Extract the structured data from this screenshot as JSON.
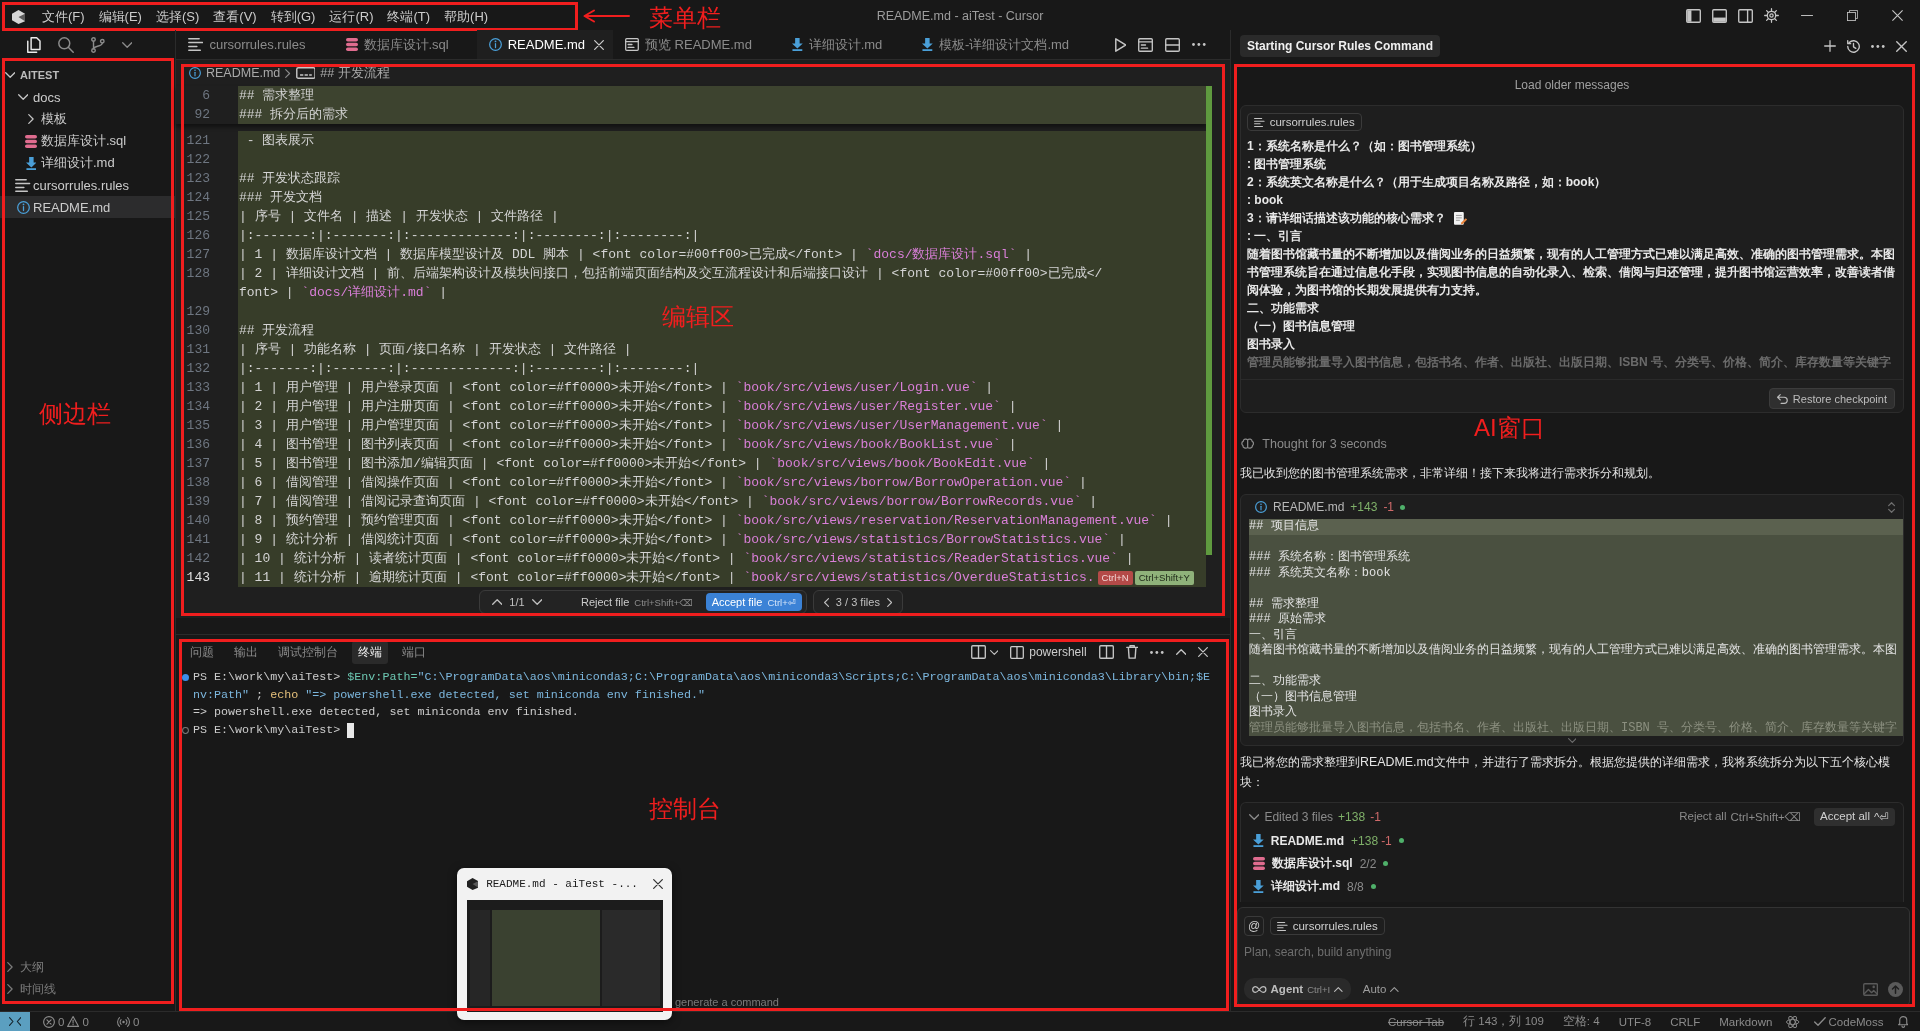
{
  "title_bar": {
    "menu": [
      "文件(F)",
      "编辑(E)",
      "选择(S)",
      "查看(V)",
      "转到(G)",
      "运行(R)",
      "终端(T)",
      "帮助(H)"
    ],
    "annotation": "菜单栏",
    "title": "README.md - aiTest - Cursor"
  },
  "sidebar": {
    "annotation": "侧边栏",
    "views": [
      {
        "kind": "explorer",
        "selected": true
      },
      {
        "kind": "search",
        "selected": false
      },
      {
        "kind": "source_control",
        "selected": false
      }
    ],
    "root": {
      "label": "AITEST",
      "expanded": true,
      "children": [
        {
          "label": "docs",
          "kind": "folder",
          "expanded": true,
          "selected": false,
          "children": [
            {
              "label": "模板",
              "kind": "folder",
              "expanded": false,
              "selected": false
            },
            {
              "label": "数据库设计.sql",
              "kind": "sql",
              "selected": false
            },
            {
              "label": "详细设计.md",
              "kind": "md",
              "selected": false
            }
          ]
        },
        {
          "label": "cursorrules.rules",
          "kind": "rules",
          "selected": false
        },
        {
          "label": "README.md",
          "kind": "readme",
          "selected": true
        }
      ]
    },
    "sections": [
      {
        "label": "大纲",
        "expanded": false
      },
      {
        "label": "时间线",
        "expanded": false
      }
    ]
  },
  "editor": {
    "annotation": "编辑区",
    "tabs": [
      {
        "label": "cursorrules.rules",
        "kind": "rules",
        "selected": false
      },
      {
        "label": "数据库设计.sql",
        "kind": "sql",
        "selected": false
      },
      {
        "label": "README.md",
        "kind": "readme",
        "selected": true
      },
      {
        "label": "预览 README.md",
        "kind": "preview",
        "selected": false
      },
      {
        "label": "详细设计.md",
        "kind": "md",
        "selected": false
      },
      {
        "label": "模板-详细设计文档.md",
        "kind": "md",
        "selected": false
      }
    ],
    "breadcrumb": [
      {
        "label": "README.md",
        "kind": "readme"
      },
      {
        "label": "## 开发流程",
        "kind": "string"
      }
    ],
    "sticky_lines": [
      {
        "number": "6",
        "text": "## 需求整理"
      },
      {
        "number": "92",
        "text": "### 拆分后的需求"
      }
    ],
    "lines": [
      {
        "number": "121",
        "text": " - 图表展示",
        "added": true,
        "current": false
      },
      {
        "number": "122",
        "added": true,
        "current": false
      },
      {
        "number": "123",
        "text": "## 开发状态跟踪",
        "added": true,
        "current": false
      },
      {
        "number": "124",
        "text": "### 开发文档",
        "added": true,
        "current": false
      },
      {
        "number": "125",
        "text": "| 序号 | 文件名 | 描述 | 开发状态 | 文件路径 |",
        "added": true,
        "current": false
      },
      {
        "number": "126",
        "text": "|:-------:|:-------:|:-------------:|:--------:|:--------:|",
        "added": true,
        "current": false
      },
      {
        "number": "127",
        "text": "| 1 | 数据库设计文档 | 数据库模型设计及 DDL 脚本 | <font color=#00ff00>已完成</font> | `docs/数据库设计.sql` |",
        "added": true,
        "current": false
      },
      {
        "number": "128",
        "text": "| 2 | 详细设计文档 | 前、后端架构设计及模块间接口，包括前端页面结构及交互流程设计和后端接口设计 | <font color=#00ff00>已完成</",
        "wrap": "font> | `docs/详细设计.md` |",
        "added": true,
        "current": false
      },
      {
        "number": "129",
        "added": true,
        "current": false
      },
      {
        "number": "130",
        "text": "## 开发流程",
        "added": true,
        "current": false
      },
      {
        "number": "131",
        "text": "| 序号 | 功能名称 | 页面/接口名称 | 开发状态 | 文件路径 |",
        "added": true,
        "current": false
      },
      {
        "number": "132",
        "text": "|:-------:|:-------:|:-------------:|:--------:|:--------:|",
        "added": true,
        "current": false
      },
      {
        "number": "133",
        "text": "| 1 | 用户管理 | 用户登录页面 | <font color=#ff0000>未开始</font> | `book/src/views/user/Login.vue` |",
        "added": true,
        "current": false
      },
      {
        "number": "134",
        "text": "| 2 | 用户管理 | 用户注册页面 | <font color=#ff0000>未开始</font> | `book/src/views/user/Register.vue` |",
        "added": true,
        "current": false
      },
      {
        "number": "135",
        "text": "| 3 | 用户管理 | 用户管理页面 | <font color=#ff0000>未开始</font> | `book/src/views/user/UserManagement.vue` |",
        "added": true,
        "current": false
      },
      {
        "number": "136",
        "text": "| 4 | 图书管理 | 图书列表页面 | <font color=#ff0000>未开始</font> | `book/src/views/book/BookList.vue` |",
        "added": true,
        "current": false
      },
      {
        "number": "137",
        "text": "| 5 | 图书管理 | 图书添加/编辑页面 | <font color=#ff0000>未开始</font> | `book/src/views/book/BookEdit.vue` |",
        "added": true,
        "current": false
      },
      {
        "number": "138",
        "text": "| 6 | 借阅管理 | 借阅操作页面 | <font color=#ff0000>未开始</font> | `book/src/views/borrow/BorrowOperation.vue` |",
        "added": true,
        "current": false
      },
      {
        "number": "139",
        "text": "| 7 | 借阅管理 | 借阅记录查询页面 | <font color=#ff0000>未开始</font> | `book/src/views/borrow/BorrowRecords.vue` |",
        "added": true,
        "current": false
      },
      {
        "number": "140",
        "text": "| 8 | 预约管理 | 预约管理页面 | <font color=#ff0000>未开始</font> | `book/src/views/reservation/ReservationManagement.vue` |",
        "added": true,
        "current": false
      },
      {
        "number": "141",
        "text": "| 9 | 统计分析 | 借阅统计页面 | <font color=#ff0000>未开始</font> | `book/src/views/statistics/BorrowStatistics.vue` |",
        "added": true,
        "current": false
      },
      {
        "number": "142",
        "text": "| 10 | 统计分析 | 读者统计页面 | <font color=#ff0000>未开始</font> | `book/src/views/statistics/ReaderStatistics.vue` |",
        "added": true,
        "current": false
      },
      {
        "number": "143",
        "text": "| 11 | 统计分析 | 逾期统计页面 | <font color=#ff0000>未开始</font> | `book/src/views/statistics/OverdueStatistics.",
        "added": true,
        "current": true,
        "actions": [
          {
            "label": "Ctrl+N",
            "kind": "reject"
          },
          {
            "label": "Ctrl+Shift+Y",
            "kind": "accept"
          }
        ]
      }
    ],
    "review_bar": {
      "hunks": "1/1",
      "reject": "Reject file",
      "reject_keys": "Ctrl+Shift+⌫",
      "accept": "Accept file",
      "accept_keys": "Ctrl+⏎",
      "files": "3 / 3 files"
    }
  },
  "panel": {
    "annotation": "控制台",
    "tabs": [
      {
        "label": "问题",
        "selected": false
      },
      {
        "label": "输出",
        "selected": false
      },
      {
        "label": "调试控制台",
        "selected": false
      },
      {
        "label": "终端",
        "selected": true
      },
      {
        "label": "端口",
        "selected": false
      }
    ],
    "shell": "powershell",
    "rows": [
      {
        "kind": "command",
        "succeeded": true,
        "prompt": "PS E:\\work\\my\\aiTest>",
        "cursor": false,
        "segments": [
          {
            "kind": "variable",
            "text": "$Env:Path="
          },
          {
            "kind": "string",
            "text": "\"C:\\ProgramData\\aos\\miniconda3;C:\\ProgramData\\aos\\miniconda3\\Scripts;C:\\ProgramData\\aos\\miniconda3\\Library\\bin;$E"
          }
        ],
        "wrap": [
          {
            "kind": "string",
            "text": "nv:Path\""
          },
          {
            "kind": "plain",
            "text": " ; "
          },
          {
            "kind": "command",
            "text": "echo"
          },
          {
            "kind": "string",
            "text": " \"=> powershell.exe detected, set miniconda env finished.\""
          }
        ]
      },
      {
        "kind": "output",
        "text": "=> powershell.exe detected, set miniconda env finished."
      },
      {
        "kind": "command",
        "succeeded": false,
        "prompt": "PS E:\\work\\my\\aiTest>",
        "cursor": true
      }
    ],
    "hint": "generate a command",
    "preview_window": {
      "title": "README.md - aiTest -..."
    }
  },
  "ai_panel": {
    "annotation": "AI窗口",
    "title": "Starting Cursor Rules Command",
    "load_older": "Load older messages",
    "user_message": {
      "chip": "cursorrules.rules",
      "lines": [
        {
          "kind": "plain",
          "text": "1：系统名称是什么？（如：图书管理系统）"
        },
        {
          "kind": "plain",
          "text": ": 图书管理系统"
        },
        {
          "kind": "plain",
          "text": "2：系统英文名称是什么？（用于生成项目名称及路径，如：book）"
        },
        {
          "kind": "plain",
          "text": ": book"
        },
        {
          "kind": "memo",
          "text": "3：请详细话描述该功能的核心需求？"
        },
        {
          "kind": "plain",
          "text": ": 一、引言"
        },
        {
          "kind": "plain",
          "text": "随着图书馆藏书量的不断增加以及借阅业务的日益频繁，现有的人工管理方式已难以满足高效、准确的图书管理需求。本图书管理系统旨在通过信息化手段，实现图书信息的自动化录入、检索、借阅与归还管理，提升图书馆运营效率，改善读者借阅体验，为图书馆的长期发展提供有力支持。"
        },
        {
          "kind": "plain",
          "text": "二、功能需求"
        },
        {
          "kind": "plain",
          "text": "（一）图书信息管理"
        },
        {
          "kind": "plain",
          "text": "图书录入"
        },
        {
          "kind": "faded",
          "text": "管理员能够批量导入图书信息，包括书名、作者、出版社、出版日期、ISBN 号、分类号、价格、简介、库存数量等关键字"
        }
      ],
      "restore": "Restore checkpoint"
    },
    "thought": "Thought for 3 seconds",
    "reply": "我已收到您的图书管理系统需求，非常详细！接下来我将进行需求拆分和规划。",
    "code_block": {
      "file": "README.md",
      "added": "+143",
      "removed": "-1",
      "lines": [
        {
          "kind": "current",
          "text": "## 项目信息"
        },
        {
          "kind": "blank"
        },
        {
          "kind": "line",
          "text": "### 系统名称：图书管理系统"
        },
        {
          "kind": "line",
          "text": "### 系统英文名称：book"
        },
        {
          "kind": "blank"
        },
        {
          "kind": "line",
          "text": "## 需求整理"
        },
        {
          "kind": "line",
          "text": "### 原始需求"
        },
        {
          "kind": "line",
          "text": "一、引言"
        },
        {
          "kind": "line",
          "text": "随着图书馆藏书量的不断增加以及借阅业务的日益频繁，现有的人工管理方式已难以满足高效、准确的图书管理需求。本图"
        },
        {
          "kind": "blank"
        },
        {
          "kind": "line",
          "text": "二、功能需求"
        },
        {
          "kind": "line",
          "text": "（一）图书信息管理"
        },
        {
          "kind": "line",
          "text": "图书录入"
        },
        {
          "kind": "faded",
          "text": "管理员能够批量导入图书信息，包括书名、作者、出版社、出版日期、ISBN 号、分类号、价格、简介、库存数量等关键字"
        }
      ]
    },
    "summary": "我已将您的需求整理到README.md文件中，并进行了需求拆分。根据您提供的详细需求，我将系统拆分为以下五个核心模块：",
    "edits": {
      "expanded": true,
      "summary": "Edited 3 files",
      "added": "+138",
      "removed": "-1",
      "reject": "Reject all",
      "reject_keys": "Ctrl+Shift+⌫",
      "accept": "Accept all",
      "accept_keys": "^⏎",
      "files": [
        {
          "name": "README.md",
          "kind": "md",
          "added": "+138",
          "removed": "-1"
        },
        {
          "name": "数据库设计.sql",
          "kind": "sql",
          "count": "2/2"
        },
        {
          "name": "详细设计.md",
          "kind": "md",
          "count": "8/8"
        }
      ]
    },
    "composer": {
      "mention": "@",
      "chip": "cursorrules.rules",
      "placeholder": "Plan, search, build anything",
      "mode": "Agent",
      "mode_keys": "Ctrl+I",
      "model": "Auto"
    }
  },
  "status_bar": {
    "errors": "0",
    "warnings": "0",
    "ports": "0",
    "items": [
      {
        "label": "Cursor Tab",
        "disabled": true
      },
      {
        "label": "行 143，列 109",
        "disabled": false
      },
      {
        "label": "空格: 4",
        "disabled": false
      },
      {
        "label": "UTF-8",
        "disabled": false
      },
      {
        "label": "CRLF",
        "disabled": false
      },
      {
        "label": "Markdown",
        "disabled": false
      }
    ],
    "extension": "CodeMoss"
  }
}
